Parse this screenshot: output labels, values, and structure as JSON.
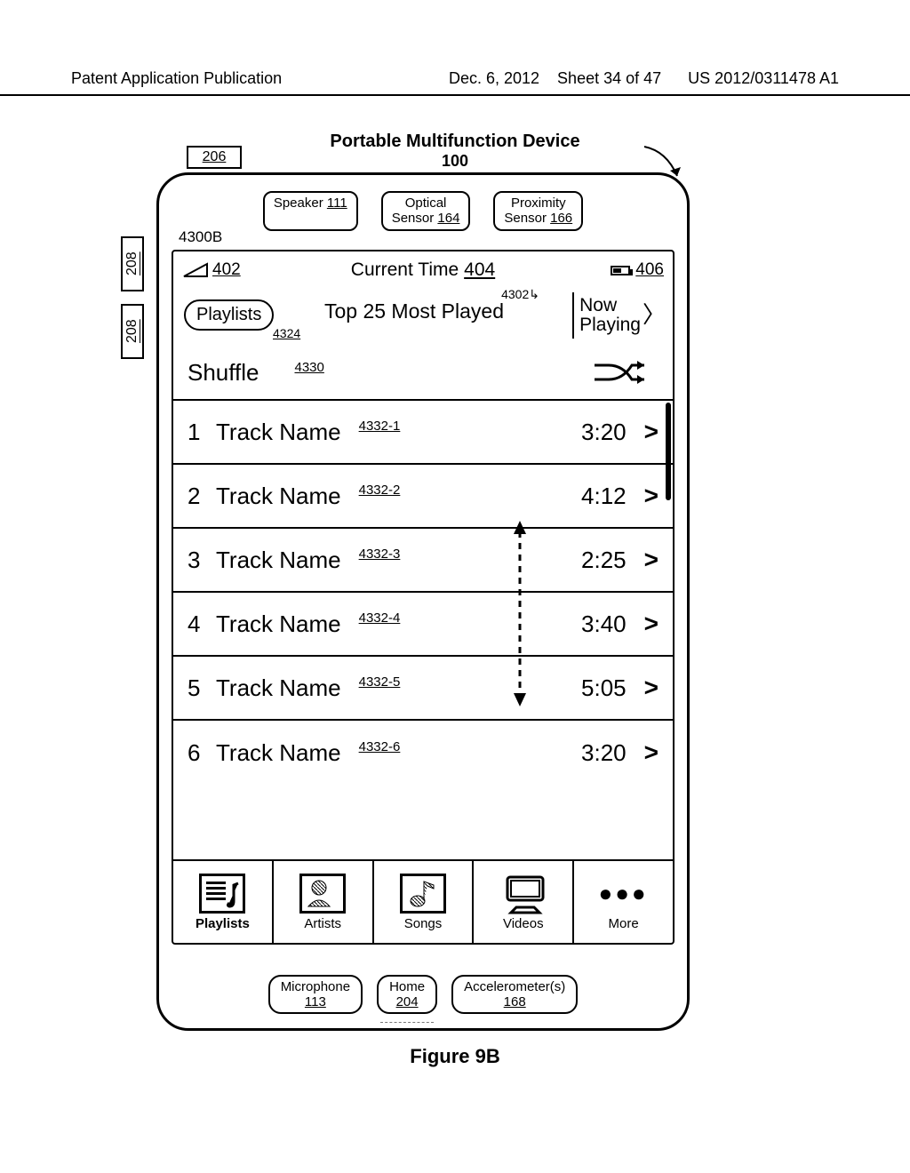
{
  "page": {
    "header_left": "Patent Application Publication",
    "header_date": "Dec. 6, 2012",
    "header_sheet": "Sheet 34 of 47",
    "header_pubno": "US 2012/0311478 A1",
    "figure_caption": "Figure 9B"
  },
  "device": {
    "title": "Portable Multifunction Device",
    "title_ref": "100",
    "ref_206": "206",
    "ref_208": "208",
    "speaker": {
      "label": "Speaker",
      "ref": "111"
    },
    "optical": {
      "label1": "Optical",
      "label2": "Sensor",
      "ref": "164"
    },
    "proximity": {
      "label1": "Proximity",
      "label2": "Sensor",
      "ref": "166"
    },
    "microphone": {
      "label": "Microphone",
      "ref": "113"
    },
    "home": {
      "label": "Home",
      "ref": "204"
    },
    "accel": {
      "label": "Accelerometer(s)",
      "ref": "168"
    },
    "ui_ref": "4300B"
  },
  "status": {
    "signal_ref": "402",
    "time_label": "Current Time",
    "time_ref": "404",
    "battery_ref": "406"
  },
  "nav": {
    "back_label": "Playlists",
    "back_ref": "4324",
    "title": "Top 25 Most Played",
    "now_ref": "4302",
    "now_line1": "Now",
    "now_line2": "Playing"
  },
  "shuffle": {
    "label": "Shuffle",
    "ref": "4330"
  },
  "tracks": [
    {
      "num": "1",
      "name": "Track Name",
      "ref": "4332-1",
      "dur": "3:20"
    },
    {
      "num": "2",
      "name": "Track Name",
      "ref": "4332-2",
      "dur": "4:12"
    },
    {
      "num": "3",
      "name": "Track Name",
      "ref": "4332-3",
      "dur": "2:25"
    },
    {
      "num": "4",
      "name": "Track Name",
      "ref": "4332-4",
      "dur": "3:40"
    },
    {
      "num": "5",
      "name": "Track Name",
      "ref": "4332-5",
      "dur": "5:05"
    },
    {
      "num": "6",
      "name": "Track Name",
      "ref": "4332-6",
      "dur": "3:20"
    }
  ],
  "tabs": {
    "playlists": "Playlists",
    "artists": "Artists",
    "songs": "Songs",
    "videos": "Videos",
    "more": "More"
  }
}
